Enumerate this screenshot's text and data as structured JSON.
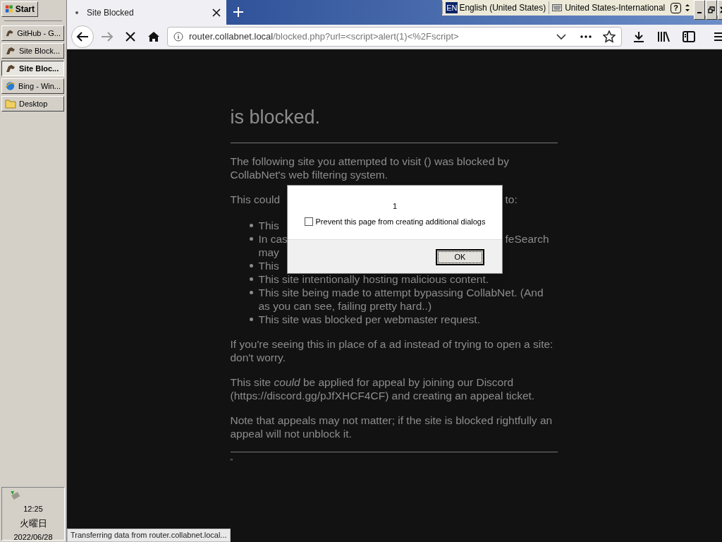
{
  "taskbar": {
    "start": "Start",
    "tasks": [
      {
        "label": "GitHub - G...",
        "kind": "app",
        "selected": false
      },
      {
        "label": "Site Block...",
        "kind": "app",
        "selected": false
      },
      {
        "label": "Site Bloc...",
        "kind": "app",
        "selected": true
      },
      {
        "label": "Bing - Win...",
        "kind": "browser",
        "selected": false
      },
      {
        "label": "Desktop",
        "kind": "folder",
        "selected": false
      }
    ],
    "clock": {
      "time": "12:25",
      "weekday": "火曜日",
      "date": "2022/06/28"
    }
  },
  "language_bar": {
    "code": "EN",
    "language": "English (United States)",
    "keyboard": "United States-International",
    "help": "?"
  },
  "browser": {
    "tab": {
      "title": "Site Blocked",
      "selected": true
    },
    "address": {
      "host": "router.collabnet.local",
      "path": "/blocked.php?url=<script>alert(1)<%2Fscript>"
    },
    "status": "Transferring data from router.collabnet.local..."
  },
  "page": {
    "heading": "is blocked.",
    "intro": "The following site you attempted to visit () was blocked by CollabNet's web filtering system.",
    "reasons_lead": {
      "left": "This could",
      "right": "to:"
    },
    "reasons": [
      {
        "lines": [
          {
            "left": "This"
          }
        ]
      },
      {
        "lines": [
          {
            "left": "In cas",
            "right": "feSearch"
          },
          {
            "left": "may"
          }
        ]
      },
      {
        "lines": [
          {
            "left": "This"
          }
        ]
      },
      {
        "lines": [
          {
            "left": "This site intentionally hosting malicious content."
          }
        ]
      },
      {
        "lines": [
          {
            "left": "This site being made to attempt bypassing CollabNet. (And as you can see, failing pretty hard..)"
          }
        ]
      },
      {
        "lines": [
          {
            "left": "This site was blocked per webmaster request."
          }
        ]
      }
    ],
    "paragraphs": [
      "If you're seeing this in place of a ad instead of trying to open a site: don't worry.",
      "This site *could* be applied for appeal by joining our Discord (https://discord.gg/pJfXHCF4CF) and creating an appeal ticket.",
      "Note that appeals may not matter; if the site is blocked rightfully an appeal will not unblock it."
    ],
    "footer": "\""
  },
  "dialog": {
    "message": "1",
    "checkbox": {
      "label": "Prevent this page from creating additional dialogs",
      "checked": false
    },
    "button": "OK"
  }
}
